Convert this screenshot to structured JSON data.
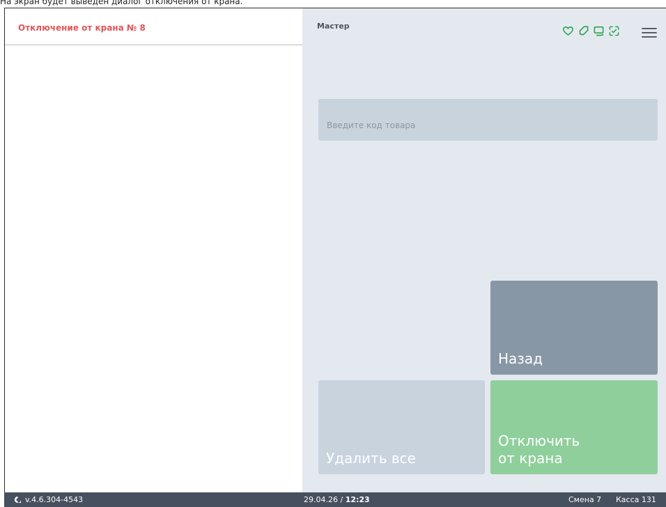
{
  "caption": "На экран будет выведен диалог отключения от крана.",
  "left_panel": {
    "title": "Отключение от крана № 8"
  },
  "header": {
    "mode": "Мастер",
    "icons": [
      "heart-icon",
      "tag-icon",
      "monitor-icon",
      "scan-check-icon",
      "hamburger-menu-icon"
    ],
    "icon_color": "#2aa44f"
  },
  "search": {
    "placeholder": "Введите код товара",
    "value": ""
  },
  "buttons": {
    "back": "Назад",
    "delete_all": "Удалить все",
    "disconnect": "Отключить\nот крана"
  },
  "statusbar": {
    "version": "v.4.6.304-4543",
    "date": "29.04.26",
    "separator": " / ",
    "time": "12:23",
    "shift": "Смена 7",
    "cashbox": "Касса 131"
  },
  "colors": {
    "title_accent": "#e0555a",
    "back_button": "#8897a6",
    "delete_button": "#c8d3de",
    "disconnect_button": "#8fcf9c",
    "statusbar": "#47505e",
    "right_panel": "#e4e9ef"
  }
}
